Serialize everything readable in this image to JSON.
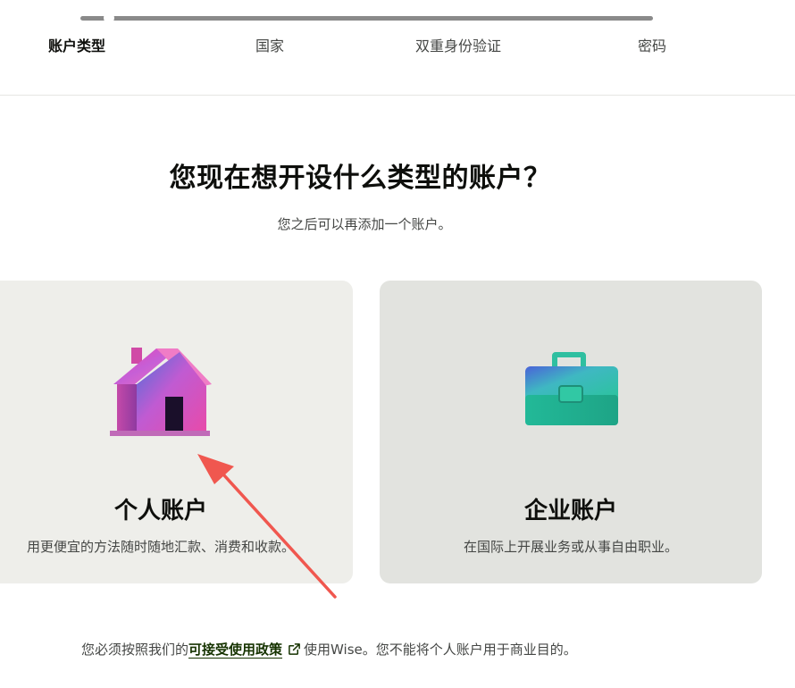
{
  "progress": {
    "fraction": 0.05
  },
  "steps": [
    {
      "label": "账户类型",
      "active": true
    },
    {
      "label": "国家",
      "active": false
    },
    {
      "label": "双重身份验证",
      "active": false
    },
    {
      "label": "密码",
      "active": false
    }
  ],
  "main": {
    "heading": "您现在想开设什么类型的账户？",
    "subheading": "您之后可以再添加一个账户。"
  },
  "cards": {
    "personal": {
      "icon": "house-icon",
      "title": "个人账户",
      "description": "用更便宜的方法随时随地汇款、消费和收款。"
    },
    "business": {
      "icon": "briefcase-icon",
      "title": "企业账户",
      "description": "在国际上开展业务或从事自由职业。"
    }
  },
  "footer": {
    "prefix": "您必须按照我们的",
    "link_label": "可接受使用政策",
    "suffix": "使用Wise。您不能将个人账户用于商业目的。"
  },
  "colors": {
    "accent_red": "#f0574f",
    "link_green": "#163300",
    "card_personal": "#eeeeea",
    "card_business": "#e2e3df"
  }
}
